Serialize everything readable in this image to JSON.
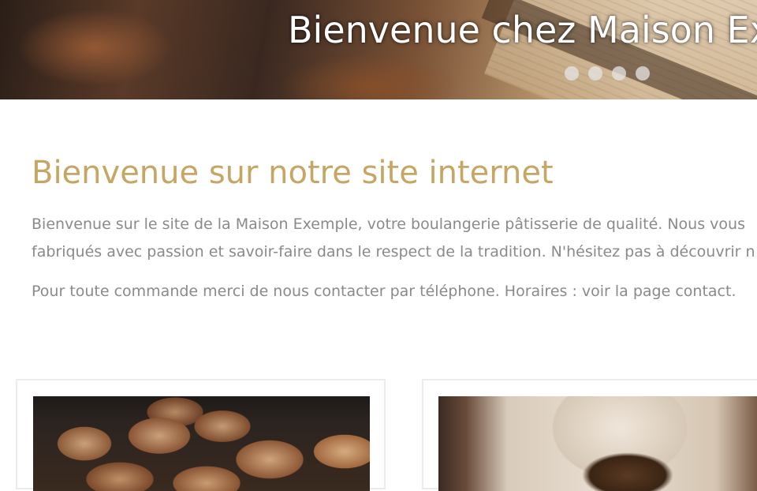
{
  "hero": {
    "title": "Bienvenue chez Maison Exemple",
    "slide_count": 4
  },
  "intro": {
    "title": "Bienvenue sur notre site internet",
    "paragraph_line_1": "Bienvenue sur le site de la Maison Exemple, votre boulangerie pâtisserie de qualité. Nous vous",
    "paragraph_line_2": "fabriqués avec passion et savoir-faire dans le respect de la tradition. N'hésitez pas à découvrir n",
    "paragraph_2": "Pour toute commande merci de nous contacter par téléphone. Horaires : voir la page contact."
  },
  "colors": {
    "heading_accent": "#c6a664",
    "body_text": "#8a8a8a",
    "card_border": "#ececec"
  }
}
